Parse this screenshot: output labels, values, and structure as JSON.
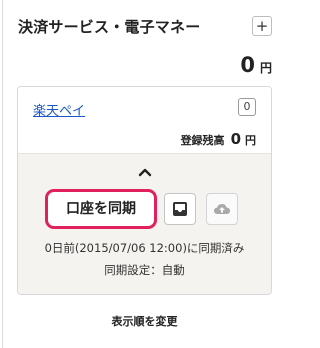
{
  "section": {
    "title": "決済サービス・電子マネー",
    "add_label": "+",
    "total_amount": "0",
    "total_unit": "円"
  },
  "account": {
    "name": "楽天ペイ",
    "count": "0",
    "balance_label": "登録残高",
    "balance_value": "0",
    "balance_unit": "円"
  },
  "actions": {
    "sync_label": "口座を同期",
    "inbox_icon": "inbox-icon",
    "upload_icon": "cloud-upload-icon",
    "collapse_icon": "chevron-up-icon"
  },
  "sync": {
    "status": "0日前(2015/07/06 12:00)に同期済み",
    "setting": "同期設定：自動"
  },
  "footer": {
    "reorder_label": "表示順を変更"
  },
  "colors": {
    "highlight_border": "#e0215d",
    "link": "#1a57c6",
    "panel_background": "#f4f3ef"
  }
}
